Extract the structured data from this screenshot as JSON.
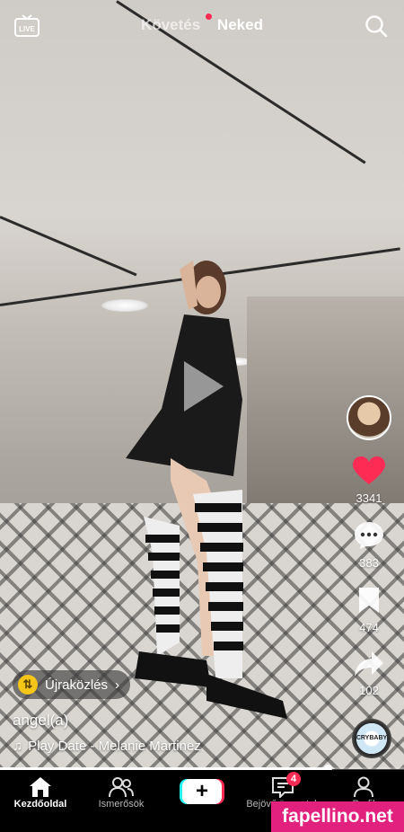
{
  "header": {
    "tab_following": "Követés",
    "tab_for_you": "Neked",
    "live_label": "LIVE"
  },
  "rail": {
    "likes": "3341",
    "comments": "383",
    "saves": "474",
    "shares": "102"
  },
  "repost": {
    "label": "Újraközlés",
    "chevron": "›"
  },
  "video": {
    "caption": "angel(a)",
    "music": "Play Date - Melanie Martinez",
    "disc_text": "CRYBABY",
    "progress": 0.81
  },
  "nav": {
    "home": "Kezdőoldal",
    "friends": "Ismerősök",
    "create": "+",
    "inbox": "Bejövő üzenetek",
    "inbox_badge": "4",
    "profile": "Profil"
  },
  "watermark": "fapellino.net",
  "colors": {
    "accent_red": "#fe2c55",
    "accent_cyan": "#25f4ee",
    "watermark": "#e2207e"
  }
}
